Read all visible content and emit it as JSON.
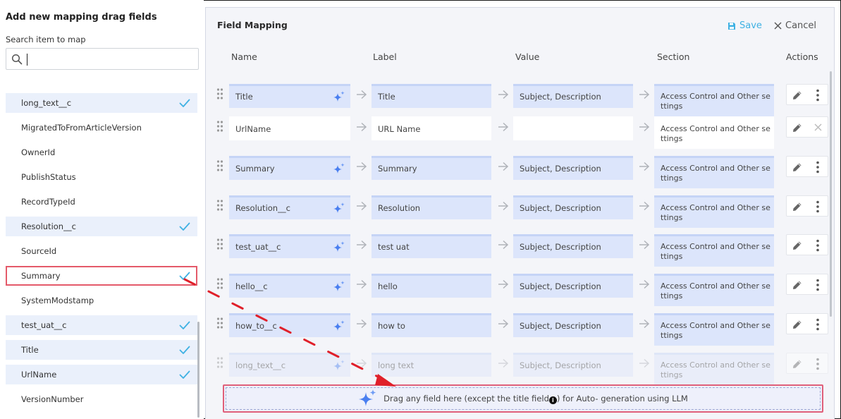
{
  "left_panel": {
    "title": "Add new mapping drag fields",
    "search_label": "Search item to map",
    "search_value": "",
    "items": [
      {
        "label": "long_text__c",
        "mapped": true
      },
      {
        "label": "MigratedToFromArticleVersion",
        "mapped": false
      },
      {
        "label": "OwnerId",
        "mapped": false
      },
      {
        "label": "PublishStatus",
        "mapped": false
      },
      {
        "label": "RecordTypeId",
        "mapped": false
      },
      {
        "label": "Resolution__c",
        "mapped": true
      },
      {
        "label": "SourceId",
        "mapped": false
      },
      {
        "label": "Summary",
        "mapped": true,
        "selected": true
      },
      {
        "label": "SystemModstamp",
        "mapped": false
      },
      {
        "label": "test_uat__c",
        "mapped": true
      },
      {
        "label": "Title",
        "mapped": true
      },
      {
        "label": "UrlName",
        "mapped": true
      },
      {
        "label": "VersionNumber",
        "mapped": false
      }
    ]
  },
  "field_mapping": {
    "title": "Field Mapping",
    "save_label": "Save",
    "cancel_label": "Cancel",
    "columns": [
      "Name",
      "Label",
      "Value",
      "Section",
      "Actions"
    ],
    "rows": [
      {
        "name": "Title",
        "label": "Title",
        "value": "Subject, Description",
        "section": "Access Control and Other settings",
        "ai": true
      },
      {
        "name": "UrlName",
        "label": "URL Name",
        "value": "",
        "section": "Access Control and Other settings",
        "ai": false
      },
      {
        "name": "Summary",
        "label": "Summary",
        "value": "Subject, Description",
        "section": "Access Control and Other settings",
        "ai": true
      },
      {
        "name": "Resolution__c",
        "label": "Resolution",
        "value": "Subject, Description",
        "section": "Access Control and Other settings",
        "ai": true
      },
      {
        "name": "test_uat__c",
        "label": "test uat",
        "value": "Subject, Description",
        "section": "Access Control and Other settings",
        "ai": true
      },
      {
        "name": "hello__c",
        "label": "hello",
        "value": "Subject, Description",
        "section": "Access Control and Other settings",
        "ai": true
      },
      {
        "name": "how_to__c",
        "label": "how to",
        "value": "Subject, Description",
        "section": "Access Control and Other settings",
        "ai": true
      },
      {
        "name": "long_text__c",
        "label": "long text",
        "value": "Subject, Description",
        "section": "Access Control and Other settings",
        "ai": true
      }
    ],
    "drop_zone": {
      "text_before": "Drag any field here (except the title field",
      "text_after": ") for Auto- generation using LLM"
    }
  },
  "colors": {
    "accent": "#3fb1e3",
    "mapped_bg": "#eaf0fb",
    "cell_bg": "#dce5fb",
    "highlight": "#e0607a",
    "annotation": "#e0202a",
    "sparkle": "#4a7ff0"
  }
}
